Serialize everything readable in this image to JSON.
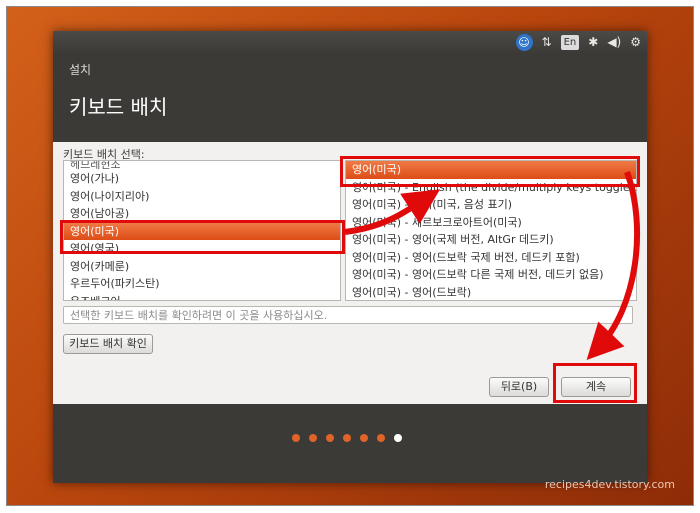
{
  "installer": {
    "window_title": "설치",
    "page_title": "키보드 배치",
    "choose_label": "키보드 배치 선택:",
    "layouts": [
      "헤므레헌조",
      "영어(가나)",
      "영어(나이지리아)",
      "영어(남아공)",
      "영어(미국)",
      "영어(영국)",
      "영어(카메룬)",
      "우르두어(파키스탄)",
      "우즈베크어"
    ],
    "selected_layout": "영어(미국)",
    "variants": [
      "영어(미국)",
      "영어(미국) - English (the divide/multiply keys toggle the la",
      "영어(미국) - 영어(미국, 음성 표기)",
      "영어(미국) - 세르보크로아트어(미국)",
      "영어(미국) - 영어(국제 버전, AltGr 데드키)",
      "영어(미국) - 영어(드보락 국제 버전, 데드키 포함)",
      "영어(미국) - 영어(드보락 다른 국제 버전, 데드키 없음)",
      "영어(미국) - 영어(드보락)"
    ],
    "selected_variant": "영어(미국)",
    "test_placeholder": "선택한 키보드 배치를 확인하려면 이 곳을 사용하십시오.",
    "detect_button": "키보드 배치 확인",
    "back_button": "뒤로(B)",
    "continue_button": "계속",
    "progress": {
      "total": 7,
      "current": 7
    }
  },
  "top_panel": {
    "icons": [
      "accessibility-icon",
      "network-icon",
      "keyboard-indicator-icon",
      "bluetooth-icon",
      "volume-icon",
      "settings-gear-icon"
    ],
    "keyboard_indicator": "En"
  },
  "watermark": "recipes4dev.tistory.com",
  "colors": {
    "accent": "#dd4c16",
    "annotation": "#e10a0a",
    "desktop": "#c4510f"
  }
}
